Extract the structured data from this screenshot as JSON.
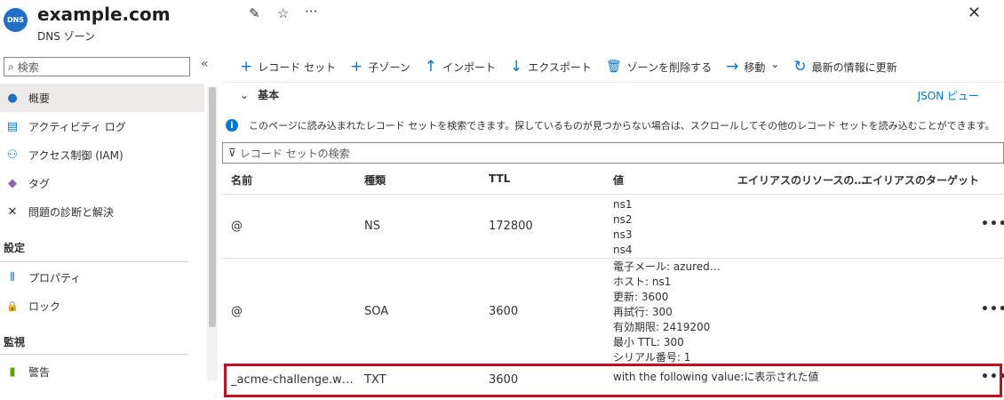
{
  "header": {
    "logo_text": "DNS",
    "title": "example.com",
    "subtitle": "DNS ゾーン",
    "pin_icon": "pin-icon",
    "star_icon": "star-icon",
    "more_icon": "ellipsis-icon",
    "close_icon": "close-icon",
    "pin_glyph": "✎",
    "star_glyph": "☆",
    "more_glyph": "···",
    "close_glyph": "✕"
  },
  "sidebar": {
    "search_placeholder": "検索",
    "search_glyph": "⌕",
    "collapse_glyph": "«",
    "items": [
      {
        "label": "概要",
        "icon": "dns-icon",
        "glyph": "●",
        "color": "#1f6fc9",
        "active": true
      },
      {
        "label": "アクティビティ ログ",
        "icon": "activity-log-icon",
        "glyph": "▤",
        "color": "#0078d4"
      },
      {
        "label": "アクセス制御 (IAM)",
        "icon": "people-icon",
        "glyph": "⚇",
        "color": "#0078d4"
      },
      {
        "label": "タグ",
        "icon": "tag-icon",
        "glyph": "◆",
        "color": "#8764b8"
      },
      {
        "label": "問題の診断と解決",
        "icon": "wrench-icon",
        "glyph": "✕",
        "color": "#323130"
      }
    ],
    "sections": [
      {
        "title": "設定",
        "items": [
          {
            "label": "プロパティ",
            "icon": "properties-icon",
            "glyph": "⦀",
            "color": "#0078d4"
          },
          {
            "label": "ロック",
            "icon": "lock-icon",
            "glyph": "🔒",
            "color": "#0078d4"
          }
        ]
      },
      {
        "title": "監視",
        "items": [
          {
            "label": "警告",
            "icon": "alert-icon",
            "glyph": "▮",
            "color": "#57a300"
          }
        ]
      }
    ]
  },
  "toolbar": {
    "buttons": [
      {
        "label": "レコード セット",
        "icon": "plus-icon",
        "glyph": "+"
      },
      {
        "label": "子ゾーン",
        "icon": "plus-icon",
        "glyph": "+"
      },
      {
        "label": "インポート",
        "icon": "arrow-up-icon",
        "glyph": "↑"
      },
      {
        "label": "エクスポート",
        "icon": "arrow-down-icon",
        "glyph": "↓"
      },
      {
        "label": "ゾーンを削除する",
        "icon": "trash-icon",
        "glyph": "🗑"
      },
      {
        "label": "移動",
        "icon": "arrow-right-icon",
        "glyph": "→",
        "dropdown": "⌄"
      },
      {
        "label": "最新の情報に更新",
        "icon": "refresh-icon",
        "glyph": "↻"
      }
    ]
  },
  "essentials": {
    "label": "基本",
    "chevron": "⌄",
    "json_view": "JSON ビュー"
  },
  "info": {
    "icon_glyph": "i",
    "text": "このページに読み込まれたレコード セットを検索できます。探しているものが見つからない場合は、スクロールしてその他のレコード セットを読み込むことができます。"
  },
  "record_search": {
    "placeholder": "レコード セットの検索",
    "filter_glyph": "⊽"
  },
  "table": {
    "columns": [
      "名前",
      "種類",
      "TTL",
      "値",
      "エイリアスのリソースの…",
      "エイリアスのターゲット"
    ],
    "rows": [
      {
        "name": "@",
        "type": "NS",
        "ttl": "172800",
        "values": [
          "ns1",
          "ns2",
          "ns3",
          "ns4"
        ]
      },
      {
        "name": "@",
        "type": "SOA",
        "ttl": "3600",
        "values": [
          "電子メール: azured…",
          "ホスト: ns1",
          "更新: 3600",
          "再試行: 300",
          "有効期限: 2419200",
          "最小 TTL: 300",
          "シリアル番号: 1"
        ]
      },
      {
        "name": "_acme-challenge.w…",
        "type": "TXT",
        "ttl": "3600",
        "values": [
          "with the following value:に表示された値"
        ],
        "highlighted": true
      }
    ],
    "more_glyph": "•••"
  },
  "colors": {
    "accent": "#0078d4",
    "highlight_border": "#c50f1f"
  }
}
